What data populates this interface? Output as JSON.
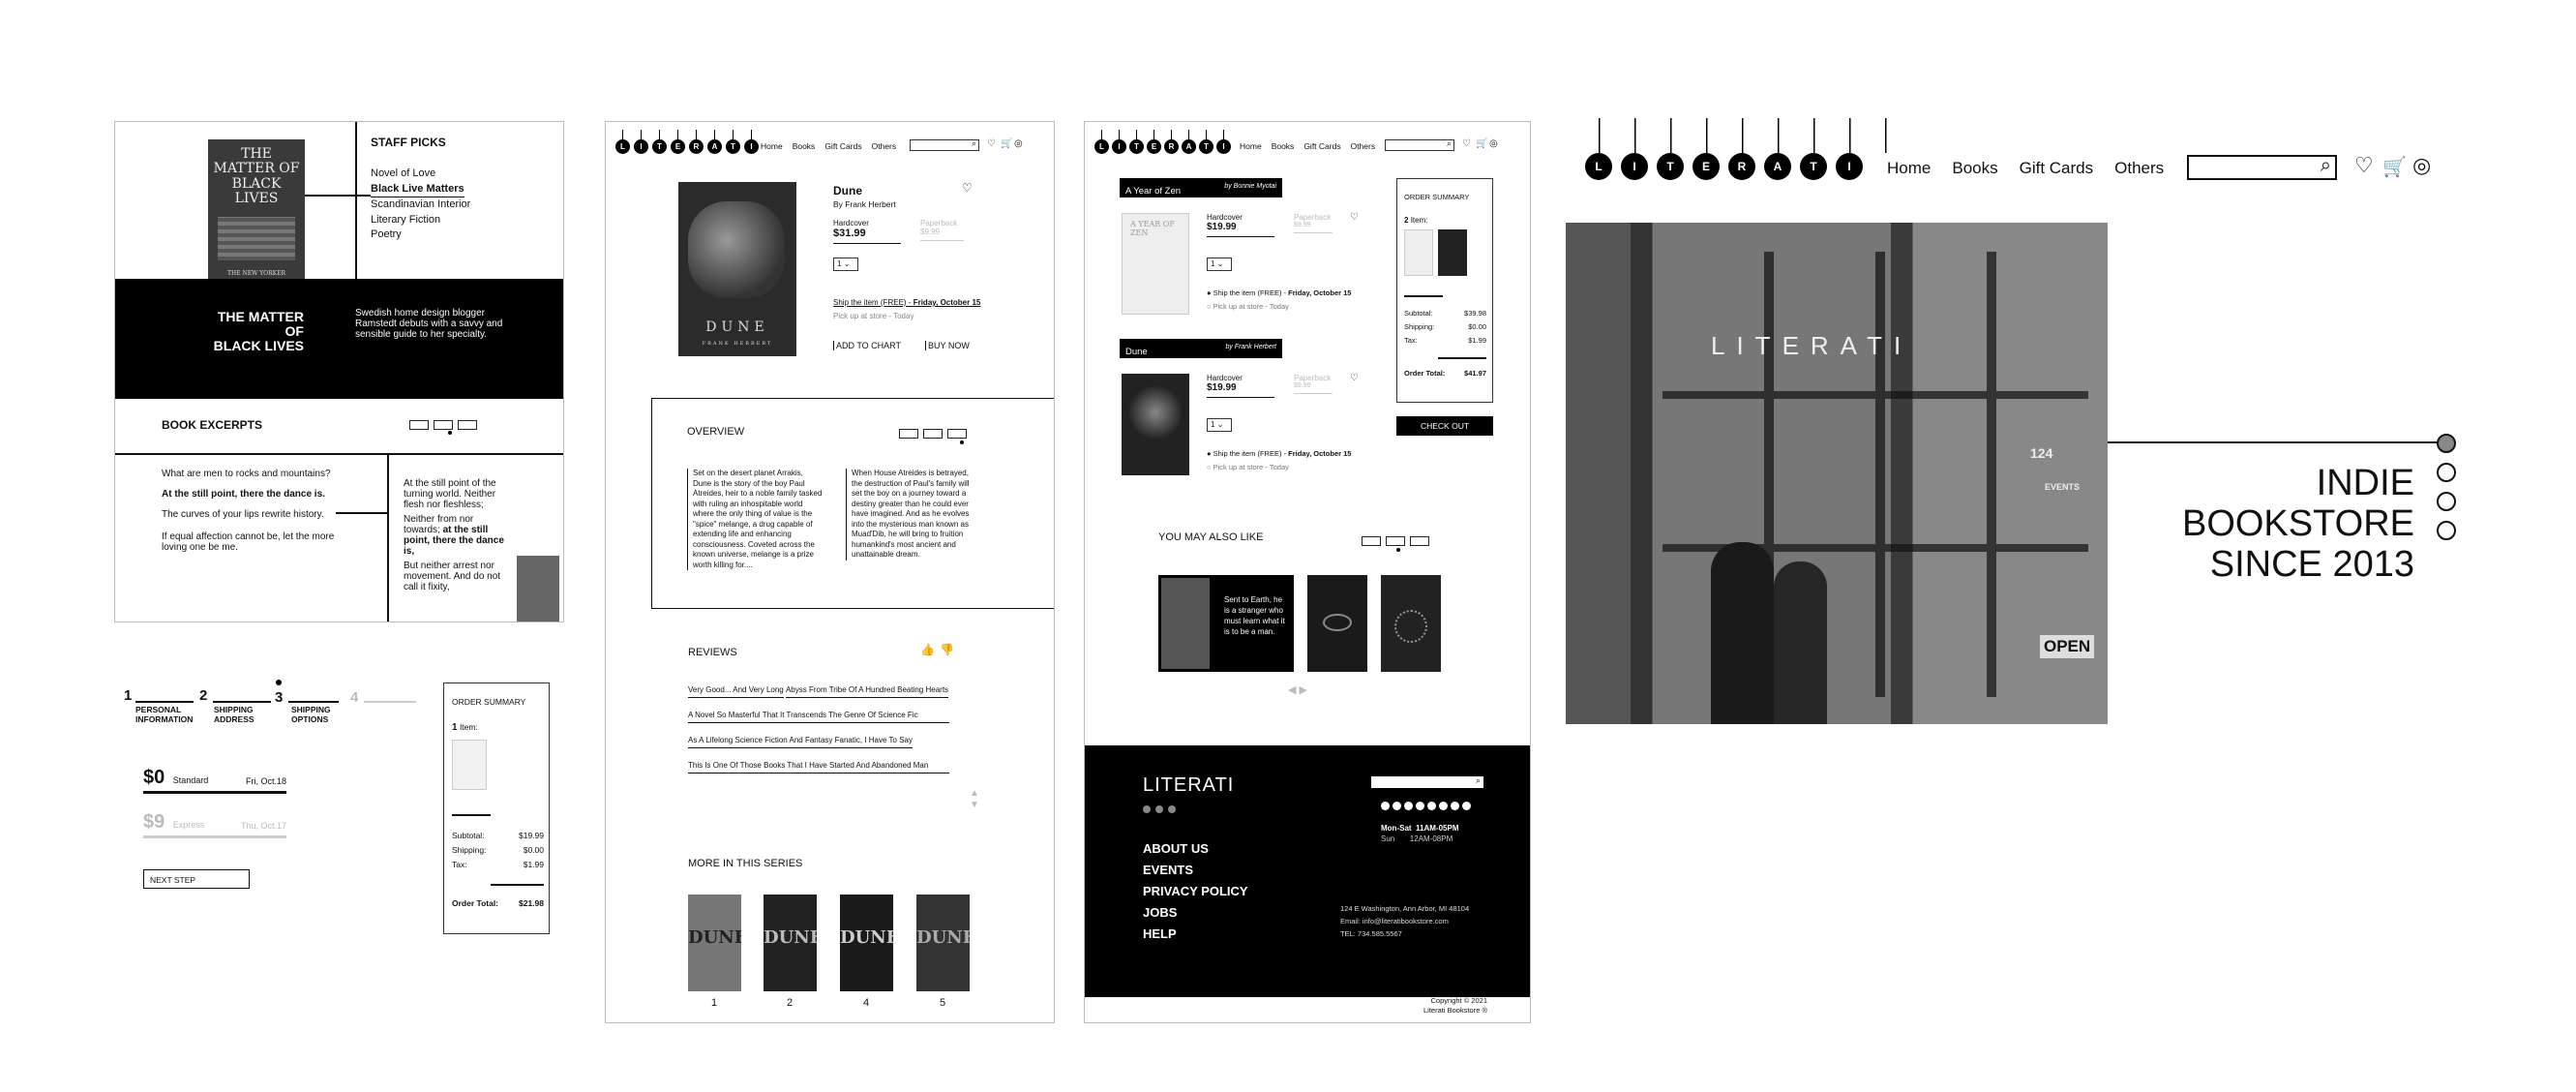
{
  "panel1": {
    "staff_picks_title": "STAFF PICKS",
    "staff_picks": [
      "Novel of Love",
      "Black Live Matters",
      "Scandinavian Interior",
      "Literary Fiction",
      "Poetry"
    ],
    "book_cover_title": "THE MATTER OF BLACK LIVES",
    "book_cover_sub": "THE NEW YORKER",
    "hero_title_1": "THE MATTER",
    "hero_title_2": "OF",
    "hero_title_3": "BLACK LIVES",
    "hero_desc": "Swedish home design blogger Ramstedt debuts with a savvy and sensible guide to her specialty.",
    "excerpts_title": "BOOK EXCERPTS",
    "excerpt_left": [
      "What are men to rocks and mountains?",
      "At the still point, there the dance is.",
      "The curves of your lips rewrite history.",
      "If equal affection cannot be, let the more loving one be me."
    ],
    "excerpt_right_1": "At the still point of the turning world. Neither flesh nor fleshless;",
    "excerpt_right_2a": "Neither from nor towards;",
    "excerpt_right_2b": "at the still point, there the dance is,",
    "excerpt_right_3": "But neither arrest nor movement. And do not call it fixity,"
  },
  "checkout": {
    "steps": [
      {
        "n": "1",
        "label": "PERSONAL INFORMATION"
      },
      {
        "n": "2",
        "label": "SHIPPING ADDRESS"
      },
      {
        "n": "3",
        "label": "SHIPPING OPTIONS"
      },
      {
        "n": "4",
        "label": ""
      }
    ],
    "opt1_price": "$0",
    "opt1_name": "Standard",
    "opt1_date": "Fri, Oct.18",
    "opt2_price": "$9",
    "opt2_name": "Express",
    "opt2_date": "Thu, Oct.17",
    "next_step": "NEXT STEP",
    "summary_title": "ORDER SUMMARY",
    "items_count": "1",
    "items_label": "Item:",
    "subtotal_label": "Subtotal:",
    "subtotal": "$19.99",
    "shipping_label": "Shipping:",
    "shipping": "$0.00",
    "tax_label": "Tax:",
    "tax": "$1.99",
    "total_label": "Order Total:",
    "total": "$21.98"
  },
  "nav": {
    "logo_letters": [
      "L",
      "I",
      "T",
      "E",
      "R",
      "A",
      "T",
      "I"
    ],
    "links": [
      "Home",
      "Books",
      "Gift Cards",
      "Others"
    ]
  },
  "product": {
    "title": "Dune",
    "author": "By Frank Herbert",
    "hardcover": "Hardcover",
    "hardcover_price": "$31.99",
    "paperback": "Paperback",
    "paperback_price": "$9.99",
    "qty": "1",
    "ship_text": "Ship the item (FREE) -",
    "ship_date": "Friday, October 15",
    "pickup": "Pick up at store - Today",
    "add_to_chart": "ADD TO CHART",
    "buy_now": "BUY NOW",
    "cover_title": "DUNE",
    "cover_author": "FRANK HERBERT",
    "overview_title": "OVERVIEW",
    "overview_1": "Set on the desert planet Arrakis, Dune is the story of the boy Paul Atreides, heir to a noble family tasked with ruling an inhospitable world where the only thing of value is the \"spice\" melange, a drug capable of extending life and enhancing consciousness. Coveted across the known universe, melange is a prize worth killing for....",
    "overview_2": "When House Atreides is betrayed, the destruction of Paul's family will set the boy on a journey toward a destiny greater than he could ever have imagined. And as he evolves into the mysterious man known as Muad'Dib, he will bring to fruition humankind's most ancient and unattainable dream.",
    "reviews_title": "REVIEWS",
    "reviews": [
      "Very Good... And Very Long",
      "Abyss From Tribe Of A Hundred Beating Hearts",
      "A Novel So Masterful That It Transcends The Genre Of Science Fic",
      "As A Lifelong Science Fiction And Fantasy Fanatic, I Have To Say",
      "This Is One Of Those Books That I Have Started And Abandoned Man"
    ],
    "series_title": "MORE IN THIS SERIES",
    "series": [
      {
        "n": "1",
        "t": "DUNE"
      },
      {
        "n": "2",
        "t": "DUNE"
      },
      {
        "n": "4",
        "t": "DUNE"
      },
      {
        "n": "5",
        "t": "DUNE"
      }
    ]
  },
  "cart": {
    "item1_title": "A Year of Zen",
    "item1_author": "by Bonnie Myotai",
    "item1_cover": "A YEAR OF ZEN",
    "item2_title": "Dune",
    "item2_author": "by Frank Herbert",
    "hardcover": "Hardcover",
    "price": "$19.99",
    "paperback": "Paperback",
    "paperback_price": "$9.99",
    "qty": "1",
    "ship_text": "Ship the item (FREE) -",
    "ship_date": "Friday, October 15",
    "pickup": "Pick up at store - Today",
    "summary_title": "ORDER SUMMARY",
    "items_count": "2",
    "items_label": "Item:",
    "subtotal_label": "Subtotal:",
    "subtotal": "$39.98",
    "shipping_label": "Shipping:",
    "shipping": "$0.00",
    "tax_label": "Tax:",
    "tax": "$1.99",
    "total_label": "Order Total:",
    "total": "$41.97",
    "checkout": "CHECK OUT",
    "also_like": "YOU MAY ALSO LIKE",
    "rec_text": "Sent to Earth, he is a stranger who must learn what it is to be a man.",
    "footer_logo": "LITERATI",
    "footer_links": [
      "ABOUT US",
      "EVENTS",
      "PRIVACY POLICY",
      "JOBS",
      "HELP"
    ],
    "hours_1_day": "Mon-Sat",
    "hours_1": "11AM-05PM",
    "hours_2_day": "Sun",
    "hours_2": "12AM-08PM",
    "address": "124 E Washington, Ann Arbor, MI 48104",
    "email": "Email: info@literatibookstore.com",
    "tel": "TEL: 734.585.5567",
    "copyright_1": "Copyright © 2021",
    "copyright_2": "Literati Bookstore ®"
  },
  "hero": {
    "line1": "INDIE",
    "line2": "BOOKSTORE",
    "line3": "SINCE 2013",
    "sign": "LITERATI",
    "number": "124",
    "open": "OPEN",
    "events": "EVENTS"
  },
  "colors": {
    "black": "#000000",
    "gray": "#bbbbbb"
  }
}
